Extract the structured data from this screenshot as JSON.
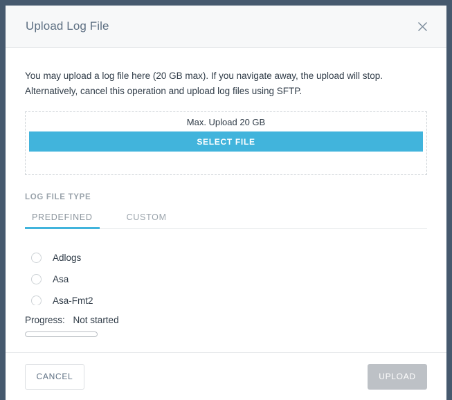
{
  "backdrop": {
    "color": "#46596e"
  },
  "modal": {
    "title": "Upload Log File",
    "close_icon": "close-icon",
    "body": {
      "intro_line_1": "You may upload a log file here (20 GB max). If you navigate away, the upload will stop.",
      "intro_line_2": "Alternatively, cancel this operation and upload log files using SFTP.",
      "dropzone": {
        "max_upload_label": "Max. Upload 20 GB",
        "select_file_label": "SELECT FILE",
        "accent_color": "#41b4dc"
      },
      "log_file_type": {
        "section_label": "LOG FILE TYPE",
        "tabs": [
          {
            "label": "PREDEFINED",
            "active": true
          },
          {
            "label": "CUSTOM",
            "active": false
          }
        ],
        "options": [
          {
            "label": "Adlogs",
            "selected": false
          },
          {
            "label": "Asa",
            "selected": false
          },
          {
            "label": "Asa-Fmt2",
            "selected": false
          }
        ]
      },
      "progress": {
        "label": "Progress:",
        "value": "Not started",
        "percent": 0
      }
    },
    "footer": {
      "cancel_label": "CANCEL",
      "upload_label": "UPLOAD",
      "upload_disabled": true
    }
  }
}
